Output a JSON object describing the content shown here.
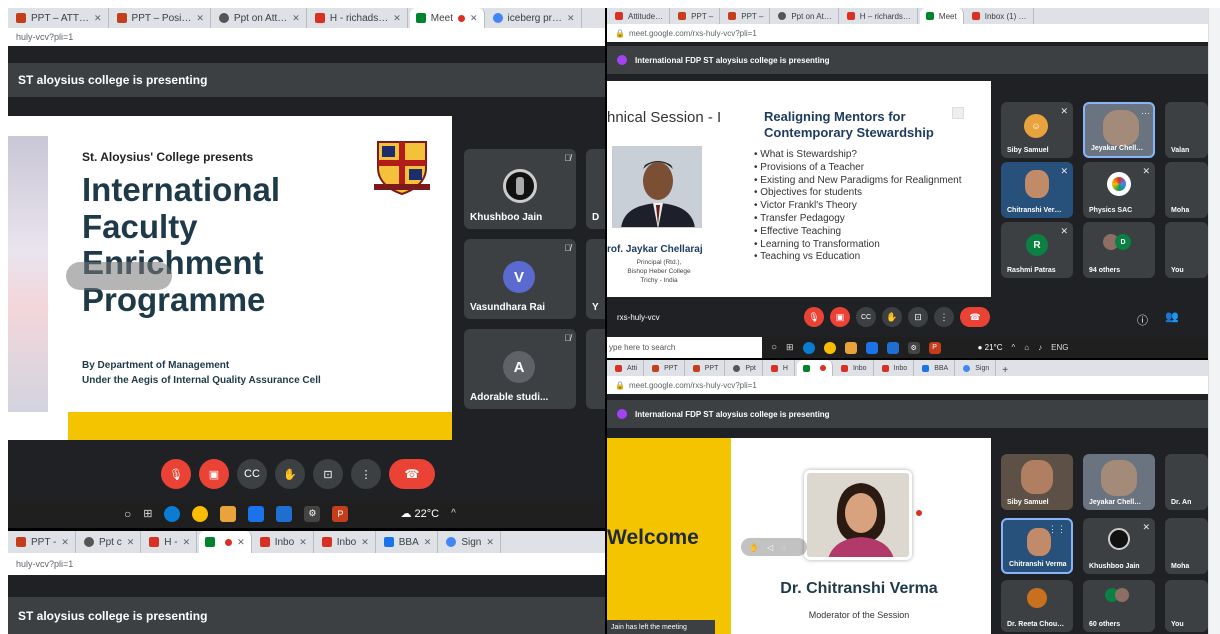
{
  "left_top": {
    "tabs": [
      "PPT – ATT…",
      "PPT – Posi…",
      "Ppt on Att…",
      "H - richads…",
      "Meet",
      "iceberg pr…"
    ],
    "url": "huly-vcv?pli=1",
    "header": "ST aloysius college is presenting",
    "slide": {
      "presenter": "St. Aloysius' College presents",
      "title_lines": [
        "International",
        "Faculty",
        "Enrichment",
        "Programme"
      ],
      "by": "By Department of Management",
      "aegis": "Under the Aegis of Internal Quality Assurance Cell"
    },
    "participants": [
      {
        "name": "Khushboo Jain",
        "initial": ""
      },
      {
        "name": "Vasundhara Rai",
        "initial": "V"
      },
      {
        "name": "Adorable studi...",
        "initial": "A"
      }
    ],
    "partial_labels": [
      "D",
      "Y"
    ],
    "weather": "22°C"
  },
  "left_bottom": {
    "tabs": [
      "PPT - ",
      "Ppt c",
      "H -",
      "",
      "Inbo",
      "Inbo",
      "BBA",
      "Sign"
    ],
    "url": "huly-vcv?pli=1",
    "header": "ST aloysius college is presenting"
  },
  "right_top": {
    "tabs": [
      "Attitude…",
      "PPT –",
      "PPT –",
      "Ppt on At…",
      "H – richards…",
      "Meet",
      "Inbox (1) …"
    ],
    "url": "meet.google.com/rxs-huly-vcv?pli=1",
    "header": "International FDP ST aloysius college is presenting",
    "slide": {
      "session": "hnical Session - I",
      "heading_lines": [
        "Realigning Mentors for",
        "Contemporary Stewardship"
      ],
      "bullets": [
        "What is Stewardship?",
        "Provisions of a Teacher",
        "Existing and New Paradigms for Realignment",
        "Objectives for students",
        "Victor Frankl's Theory",
        "Transfer Pedagogy",
        "Effective Teaching",
        "Learning to Transformation",
        "Teaching vs Education"
      ],
      "speaker": "rof. Jaykar Chellaraj",
      "speaker_lines": [
        "Principal (Rtd.),",
        "Bishop Heber College",
        "Trichy - India"
      ]
    },
    "participants": [
      "Siby Samuel",
      "Jeyakar Chell…",
      "Valan",
      "Chitranshi Ver…",
      "Physics SAC",
      "Moha",
      "Rashmi Patras",
      "94 others",
      "You"
    ],
    "initials": {
      "rashmi": "R",
      "others": "D"
    },
    "meeting_code": "rxs-huly-vcv",
    "search": "ype here to search",
    "weather": "21°C",
    "lang": "ENG"
  },
  "right_bottom": {
    "tabs": [
      "Atti",
      "PPT",
      "PPT",
      "Ppt",
      "H",
      "",
      "Inbo",
      "Inbo",
      "BBA",
      "Sign"
    ],
    "url": "meet.google.com/rxs-huly-vcv?pli=1",
    "header": "International FDP ST aloysius college is presenting",
    "slide": {
      "welcome": "Welcome",
      "name": "Dr. Chitranshi Verma",
      "role": "Moderator of the Session"
    },
    "participants": [
      "Siby Samuel",
      "Jeyakar Chell…",
      "Dr. An",
      "Chitranshi Verma",
      "Khushboo Jain",
      "Moha",
      "Dr. Reeta Chou…",
      "60 others",
      "You"
    ],
    "toast": "Jain has left the meeting"
  },
  "icons": {
    "mic": "mic-off-icon",
    "cam": "camera-off-icon",
    "cc": "captions-icon",
    "hand": "raise-hand-icon",
    "present": "present-icon",
    "more": "more-icon",
    "end": "end-call-icon"
  }
}
